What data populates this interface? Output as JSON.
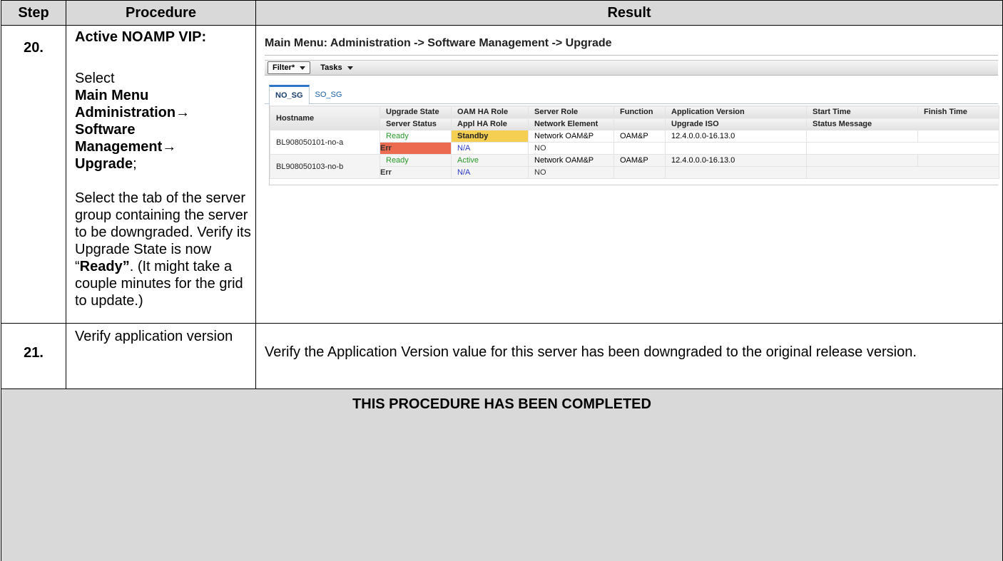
{
  "header": {
    "step": "Step",
    "procedure": "Procedure",
    "result": "Result"
  },
  "step20": {
    "number": "20.",
    "procedure": {
      "heading": "Active NOAMP VIP:",
      "select": "Select",
      "menu_line1": "Main Menu",
      "menu_line2": "Administration→",
      "menu_line3": "Software",
      "menu_line4": "Management→",
      "menu_line5": "Upgrade",
      "menu_line5_suffix": ";",
      "para_pre": "Select the tab of the server group containing the server to be downgraded. Verify its Upgrade State is now “",
      "para_bold": "Ready”",
      "para_post": ". (It might take a couple minutes for the grid to update.)"
    },
    "screenshot": {
      "title": "Main Menu: Administration -> Software Management -> Upgrade",
      "toolbar": {
        "filter_label": "Filter*",
        "tasks_label": "Tasks"
      },
      "tabs": [
        "NO_SG",
        "SO_SG"
      ],
      "columns": {
        "row1": [
          "Hostname",
          "Upgrade State",
          "OAM HA Role",
          "Server Role",
          "Function",
          "Application Version",
          "Start Time",
          "Finish Time"
        ],
        "row2": [
          "Server Status",
          "Appl HA Role",
          "Network Element",
          "",
          "Upgrade ISO",
          "Status Message"
        ]
      },
      "servers": [
        {
          "hostname": "BL908050101-no-a",
          "upgrade_state": "Ready",
          "oam_ha_role": "Standby",
          "server_role": "Network OAM&P",
          "function": "OAM&P",
          "application_version": "12.4.0.0.0-16.13.0",
          "start_time": "",
          "finish_time": "",
          "server_status": "Err",
          "appl_ha_role": "N/A",
          "network_element": "NO",
          "upgrade_iso": "",
          "status_message": ""
        },
        {
          "hostname": "BL908050103-no-b",
          "upgrade_state": "Ready",
          "oam_ha_role": "Active",
          "server_role": "Network OAM&P",
          "function": "OAM&P",
          "application_version": "12.4.0.0.0-16.13.0",
          "start_time": "",
          "finish_time": "",
          "server_status": "Err",
          "appl_ha_role": "N/A",
          "network_element": "NO",
          "upgrade_iso": "",
          "status_message": ""
        }
      ],
      "colors": {
        "ready": "#2a9a2a",
        "standby": "#f5cf52",
        "err": "#ec6a4f",
        "na": "#2a39c9"
      }
    }
  },
  "step21": {
    "number": "21.",
    "procedure": "Verify application version",
    "result": "Verify the Application Version value for this server has been downgraded to the original release version."
  },
  "footer": {
    "completed": "THIS PROCEDURE HAS BEEN COMPLETED"
  }
}
